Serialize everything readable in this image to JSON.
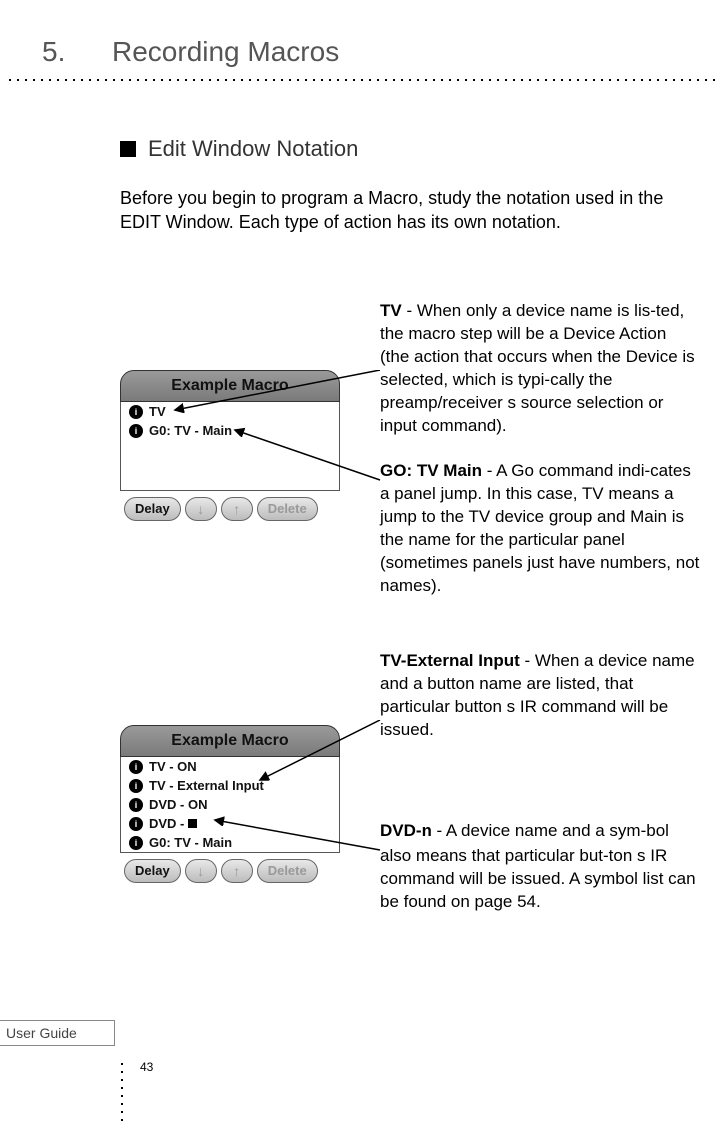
{
  "chapter": {
    "number": "5.",
    "title": "Recording Macros"
  },
  "section": {
    "heading": "Edit Window Notation"
  },
  "intro": "Before you begin to program a Macro, study the notation used in the EDIT Window. Each type of action has its own notation.",
  "macro1": {
    "header": "Example Macro",
    "rows": [
      "TV",
      "G0: TV - Main"
    ],
    "controls": {
      "delay": "Delay",
      "down": "↓",
      "up": "↑",
      "delete": "Delete"
    }
  },
  "macro2": {
    "header": "Example Macro",
    "rows": [
      "TV - ON",
      "TV - External Input",
      "DVD - ON",
      "DVD - ■",
      "G0: TV - Main"
    ],
    "controls": {
      "delay": "Delay",
      "down": "↓",
      "up": "↑",
      "delete": "Delete"
    }
  },
  "expl": {
    "tv": {
      "lead": "TV",
      "body": " - When only a device name is lis-ted, the macro step will be a Device Action (the action that occurs when the Device is selected, which is typi-cally the preamp/receiver s source selection or input command)."
    },
    "go": {
      "lead": "GO: TV Main",
      "body": " - A Go command indi-cates a panel jump. In this case,  TV  means a jump to the TV device group and Main is the name for the particular panel (sometimes panels just have numbers, not names)."
    },
    "ext": {
      "lead": "TV-External Input",
      "body": " - When a device name and a button name are listed, that particular button s IR command will be issued."
    },
    "dvd": {
      "lead_pre": "DVD-",
      "lead_sym": "n",
      "body": "  - A device name and a sym-bol also means that particular but-ton s IR command will be issued. A symbol list can be found on page 54."
    }
  },
  "footer": {
    "label": "User Guide",
    "page": "43"
  }
}
